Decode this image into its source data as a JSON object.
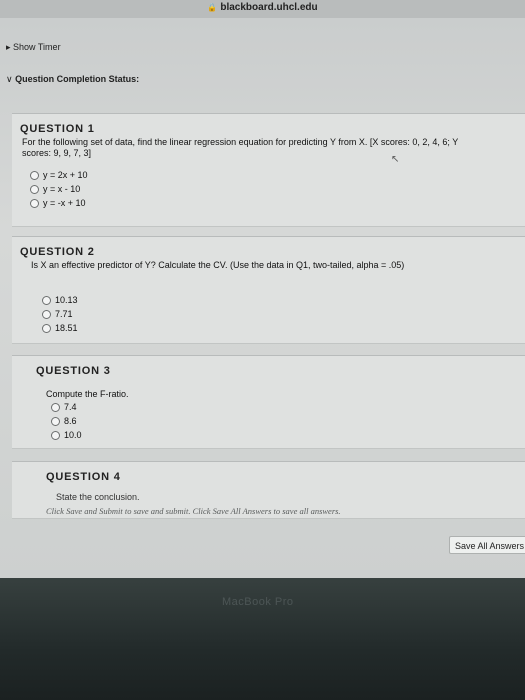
{
  "browser": {
    "url": "blackboard.uhcl.edu",
    "lock_icon": "lock-icon"
  },
  "header": {
    "show_timer": "Show Timer",
    "question_completion_status": "Question Completion Status:"
  },
  "questions": [
    {
      "title": "QUESTION 1",
      "text_line1": "For the following set of data, find the linear regression equation for predicting Y from X. [X scores: 0, 2, 4, 6; Y",
      "text_line2": "scores: 9, 9, 7, 3]",
      "options": [
        "y = 2x + 10",
        "y = x - 10",
        "y = -x + 10"
      ]
    },
    {
      "title": "QUESTION 2",
      "text_line1": "Is X an effective predictor of Y? Calculate the CV. (Use the data in Q1, two-tailed, alpha = .05)",
      "options": [
        "10.13",
        "7.71",
        "18.51"
      ]
    },
    {
      "title": "QUESTION 3",
      "text_line1": "Compute the F-ratio.",
      "options": [
        "7.4",
        "8.6",
        "10.0"
      ]
    },
    {
      "title": "QUESTION 4",
      "text_line1": "State the conclusion."
    }
  ],
  "footer": {
    "note": "Click Save and Submit to save and submit. Click Save All Answers to save all answers.",
    "save_all": "Save All Answers"
  },
  "bezel": {
    "label": "MacBook Pro"
  }
}
